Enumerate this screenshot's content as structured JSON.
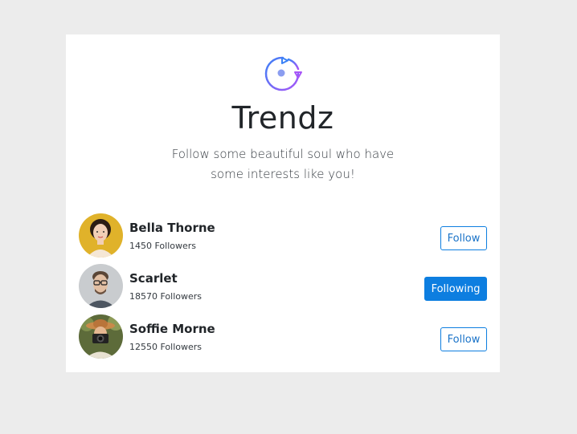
{
  "app": {
    "brand": "Trendz",
    "tagline": "Follow some beautiful soul who have some interests like you!",
    "logo_icon": "play-refresh-icon",
    "accent_color": "#0d7ee0",
    "gradient": [
      "#3b82f6",
      "#a855f7"
    ]
  },
  "users": [
    {
      "name": "Bella Thorne",
      "followers": "1450 Followers",
      "button_label": "Follow",
      "following": false
    },
    {
      "name": "Scarlet",
      "followers": "18570 Followers",
      "button_label": "Following",
      "following": true
    },
    {
      "name": "Soffie Morne",
      "followers": "12550 Followers",
      "button_label": "Follow",
      "following": false
    }
  ]
}
